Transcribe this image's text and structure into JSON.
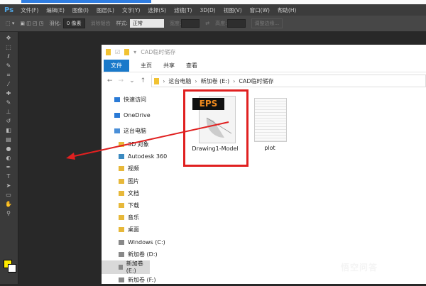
{
  "photoshop": {
    "logo": "Ps",
    "menu": [
      "文件(F)",
      "编辑(E)",
      "图像(I)",
      "图层(L)",
      "文字(Y)",
      "选择(S)",
      "滤镜(T)",
      "3D(D)",
      "视图(V)",
      "窗口(W)",
      "帮助(H)"
    ],
    "options": {
      "feather_label": "羽化:",
      "feather_value": "0 像素",
      "antialias": "消除锯齿",
      "style_label": "样式:",
      "style_value": "正常",
      "width_label": "宽度:",
      "height_label": "高度:",
      "refine_edge": "调整边缘..."
    },
    "foreground_color": "#ffea00",
    "background_color": "#ffffff"
  },
  "explorer": {
    "title": "CAD临时储存",
    "ribbon_tabs": [
      "文件",
      "主页",
      "共享",
      "查看"
    ],
    "breadcrumb": [
      "这台电脑",
      "新加卷 (E:)",
      "CAD临时储存"
    ],
    "nav": [
      {
        "label": "快速访问",
        "icon": "star-icon",
        "top": true
      },
      {
        "label": "OneDrive",
        "icon": "cloud-icon",
        "top": true
      },
      {
        "label": "这台电脑",
        "icon": "computer-icon",
        "top": true
      },
      {
        "label": "3D 对象",
        "icon": "folder-3d-icon"
      },
      {
        "label": "Autodesk 360",
        "icon": "autodesk-icon"
      },
      {
        "label": "视频",
        "icon": "video-folder-icon"
      },
      {
        "label": "图片",
        "icon": "pictures-folder-icon"
      },
      {
        "label": "文档",
        "icon": "documents-folder-icon"
      },
      {
        "label": "下载",
        "icon": "downloads-folder-icon"
      },
      {
        "label": "音乐",
        "icon": "music-folder-icon"
      },
      {
        "label": "桌面",
        "icon": "desktop-folder-icon"
      },
      {
        "label": "Windows (C:)",
        "icon": "drive-icon"
      },
      {
        "label": "新加卷 (D:)",
        "icon": "drive-icon"
      },
      {
        "label": "新加卷 (E:)",
        "icon": "drive-icon",
        "selected": true
      },
      {
        "label": "新加卷 (F:)",
        "icon": "drive-icon"
      }
    ],
    "files": [
      {
        "name": "Drawing1-Model",
        "badge": "EPS",
        "highlighted": true
      },
      {
        "name": "plot"
      }
    ]
  },
  "annotation_color": "#e02020",
  "watermark": "悟空问答"
}
